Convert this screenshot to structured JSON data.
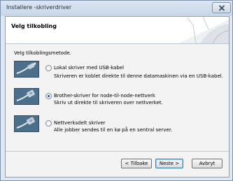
{
  "window": {
    "title": "Installere -skriverdriver",
    "close_icon": "close-icon"
  },
  "header": {
    "title": "Velg tilkobling",
    "graphic_icon": "wizard-banner-graphic"
  },
  "main": {
    "method_label": "Velg tilkoblingsmetode.",
    "selected_option": 1,
    "options": [
      {
        "title": "Lokal skriver med USB-kabel",
        "description": "Skriveren er koblet direkte til denne datamaskinen via en USB-kabel.",
        "icon": "usb-cable-icon",
        "checked": false
      },
      {
        "title": "Brother-skriver for node-til-node-nettverk",
        "description": "Skriv ut direkte til skriveren over nettverket.",
        "icon": "network-cable-icon",
        "checked": true
      },
      {
        "title": "Nettverksdelt skriver",
        "description": "Alle jobber sendes til en kø på en sentral server.",
        "icon": "shared-network-cable-icon",
        "checked": false
      }
    ]
  },
  "footer": {
    "back_label": "< Tilbake",
    "next_label": "Neste >",
    "cancel_label": "Avbryt"
  },
  "colors": {
    "window_frame": "#dfe8f2",
    "panel_background": "#f3f3f3",
    "icon_background": "#4c6f8c",
    "radio_checked": "#1b4d8c",
    "default_button_border": "#3c7fb1"
  }
}
